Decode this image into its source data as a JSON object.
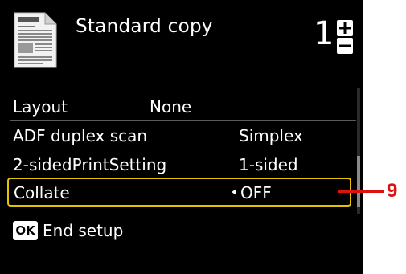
{
  "header": {
    "title": "Standard copy",
    "copies": "1",
    "doc_icon": "document-icon",
    "increment_icon": "plus-icon",
    "decrement_icon": "minus-icon"
  },
  "settings": [
    {
      "label": "Layout",
      "value": "None"
    },
    {
      "label": "ADF duplex scan",
      "value": "Simplex"
    },
    {
      "label": "2-sidedPrintSetting",
      "value": "1-sided"
    },
    {
      "label": "Collate",
      "value": "OFF",
      "selected": true
    }
  ],
  "footer": {
    "ok_label": "OK",
    "text": "End setup"
  },
  "callout": {
    "number": "9",
    "color": "#e01010"
  },
  "colors": {
    "screen_bg": "#000000",
    "text": "#ffffff",
    "highlight_border": "#e3c200"
  }
}
